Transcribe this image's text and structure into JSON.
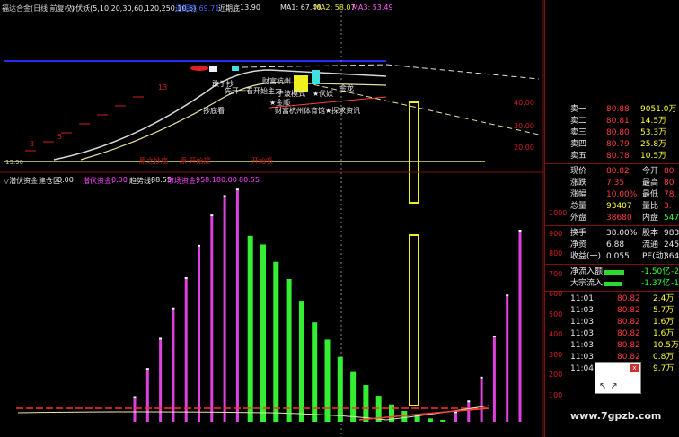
{
  "top_bar": {
    "title": "福达合金(日线 前复权)",
    "indicator": "▽伏妖(5,10,20,30,60,120,250,10,5)",
    "highlight": "近期底 69.71",
    "recent_low_label": "近期底",
    "recent_low_value": "13.90",
    "ma1": "MA1: 67.40",
    "ma2": "MA2: 58.07",
    "ma3": "MA3: 53.49"
  },
  "upper_chart": {
    "labels": [
      "敢于抄",
      "先开一看开始主力",
      "财富杭州",
      "宁波模式",
      "★伏妖",
      "金龙",
      "★金顺",
      "财富杭州体育馆★探求资讯",
      "抄底看"
    ],
    "numbers": [
      "13",
      "5",
      "3"
    ],
    "bottom_labels": [
      "原之抄底",
      "原·开始提",
      "开始吸"
    ],
    "low_marker": "13.90",
    "axis": [
      "40.00",
      "30.00",
      "20.00"
    ]
  },
  "lower_chart": {
    "header": {
      "name": "▽潜伏资金",
      "build_label": "建仓区:",
      "build_value": "0.00",
      "hidden_label": "潜伏资金:",
      "hidden_value": "0.00",
      "trend_label": "趋势线:",
      "trend_value": "88.55",
      "market_label": "市场资金:",
      "market_value": "958.18",
      "v1": "0.00",
      "v2": "80.55"
    },
    "axis": [
      "1000",
      "900",
      "800",
      "700",
      "600",
      "500",
      "400",
      "300",
      "200",
      "100"
    ]
  },
  "chart_data": {
    "type": "bar",
    "series": [
      {
        "name": "潜伏资金",
        "color": "#e040e0",
        "values": [
          0,
          0,
          0,
          0,
          0,
          0,
          0,
          0,
          0,
          0,
          0,
          0,
          0,
          0,
          0,
          0,
          0,
          0,
          0,
          0,
          0,
          0,
          0,
          0,
          0,
          0,
          0,
          0,
          0,
          0,
          0,
          0,
          0,
          0,
          0,
          0,
          0,
          0,
          0,
          0,
          0
        ]
      },
      {
        "name": "市场资金"
      }
    ],
    "bars": [
      {
        "v": 110,
        "c": "magenta"
      },
      {
        "v": 240,
        "c": "magenta"
      },
      {
        "v": 380,
        "c": "magenta"
      },
      {
        "v": 520,
        "c": "magenta"
      },
      {
        "v": 660,
        "c": "magenta"
      },
      {
        "v": 810,
        "c": "magenta"
      },
      {
        "v": 950,
        "c": "magenta"
      },
      {
        "v": 1040,
        "c": "magenta"
      },
      {
        "v": 1070,
        "c": "magenta"
      },
      {
        "v": 860,
        "c": "green"
      },
      {
        "v": 820,
        "c": "green"
      },
      {
        "v": 740,
        "c": "green"
      },
      {
        "v": 660,
        "c": "green"
      },
      {
        "v": 560,
        "c": "green"
      },
      {
        "v": 460,
        "c": "green"
      },
      {
        "v": 380,
        "c": "green"
      },
      {
        "v": 300,
        "c": "green"
      },
      {
        "v": 230,
        "c": "green"
      },
      {
        "v": 170,
        "c": "green"
      },
      {
        "v": 120,
        "c": "green"
      },
      {
        "v": 80,
        "c": "green"
      },
      {
        "v": 50,
        "c": "green"
      },
      {
        "v": 30,
        "c": "green"
      },
      {
        "v": 15,
        "c": "green"
      },
      {
        "v": 5,
        "c": "green"
      },
      {
        "v": 40,
        "c": "magenta"
      },
      {
        "v": 90,
        "c": "magenta"
      },
      {
        "v": 200,
        "c": "magenta"
      },
      {
        "v": 390,
        "c": "magenta"
      },
      {
        "v": 580,
        "c": "magenta"
      },
      {
        "v": 880,
        "c": "magenta"
      }
    ],
    "ylim": [
      0,
      1100
    ]
  },
  "quote_panel": {
    "sell": [
      {
        "label": "卖一",
        "price": "80.88",
        "vol": "9051.0万"
      },
      {
        "label": "卖二",
        "price": "80.81",
        "vol": "14.5万"
      },
      {
        "label": "卖三",
        "price": "80.80",
        "vol": "53.3万"
      },
      {
        "label": "卖四",
        "price": "80.79",
        "vol": "25.8万"
      },
      {
        "label": "卖五",
        "price": "80.78",
        "vol": "10.5万"
      }
    ],
    "stats": [
      {
        "l1": "现价",
        "v1": "80.82",
        "l2": "今开",
        "v2": "80"
      },
      {
        "l1": "涨跌",
        "v1": "7.35",
        "l2": "最高",
        "v2": "80"
      },
      {
        "l1": "涨幅",
        "v1": "10.00%",
        "l2": "最低",
        "v2": "78."
      },
      {
        "l1": "总量",
        "v1": "93407",
        "l2": "量比",
        "v2": "3."
      },
      {
        "l1": "外盘",
        "v1": "38680",
        "l2": "内盘",
        "v2": "5473"
      }
    ],
    "stats2": [
      {
        "l1": "换手",
        "v1": "38.00%",
        "l2": "股本",
        "v2": "9830"
      },
      {
        "l1": "净资",
        "v1": "6.88",
        "l2": "流通",
        "v2": "2458"
      },
      {
        "l1": "收益(一)",
        "v1": "0.055",
        "l2": "PE(动)",
        "v2": "364"
      }
    ],
    "flows": [
      {
        "label": "净流入额",
        "value": "-1.50亿",
        "extra": "-20",
        "bar": 0.55
      },
      {
        "label": "大宗流入",
        "value": "-1.37亿",
        "extra": "-18",
        "bar": 0.5
      }
    ],
    "ticks": [
      {
        "t": "11:01",
        "p": "80.82",
        "v": "2.4万"
      },
      {
        "t": "11:03",
        "p": "80.82",
        "v": "5.7万"
      },
      {
        "t": "11:03",
        "p": "80.82",
        "v": "1.6万"
      },
      {
        "t": "11:03",
        "p": "80.82",
        "v": "1.6万"
      },
      {
        "t": "11:03",
        "p": "80.82",
        "v": "10.5万"
      },
      {
        "t": "11:03",
        "p": "80.82",
        "v": "0.8万"
      },
      {
        "t": "11:04",
        "p": "80.82",
        "v": "9.7万"
      }
    ],
    "tool_close": "x",
    "tool_arrows": "↖↗"
  },
  "watermark": "www.7gpzb.com"
}
